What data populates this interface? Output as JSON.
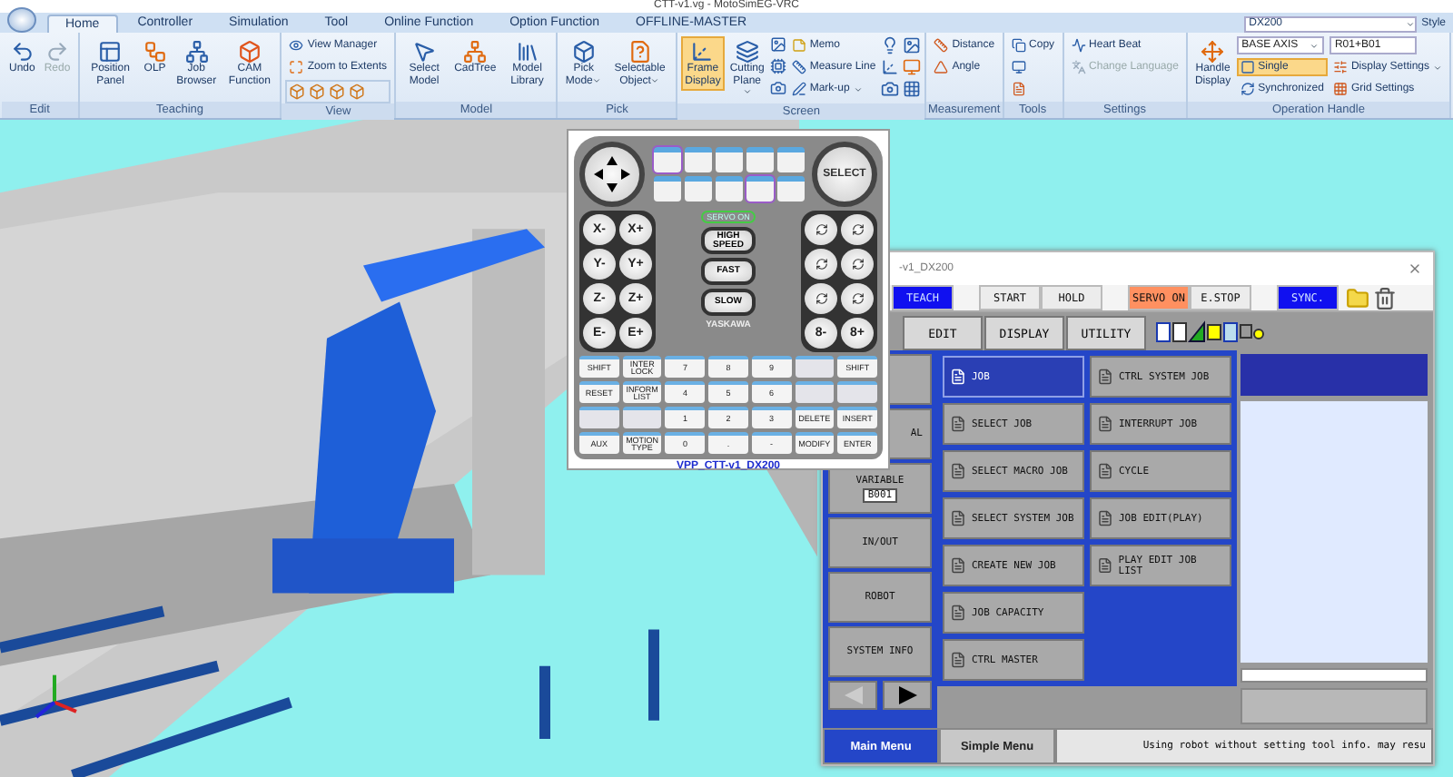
{
  "window": {
    "title": "CTT-v1.vg - MotoSimEG-VRC"
  },
  "ribbon": {
    "tabs": [
      {
        "label": "Home",
        "selected": true
      },
      {
        "label": "Controller",
        "selected": false
      },
      {
        "label": "Simulation",
        "selected": false
      },
      {
        "label": "Tool",
        "selected": false
      },
      {
        "label": "Online Function",
        "selected": false
      },
      {
        "label": "Option Function",
        "selected": false
      },
      {
        "label": "OFFLINE-MASTER",
        "selected": false
      }
    ],
    "controller": "DX200",
    "style_menu": "Style",
    "groups": [
      {
        "label": "Edit",
        "items": [
          {
            "kind": "large",
            "label": "Undo"
          },
          {
            "kind": "large",
            "label": "Redo",
            "disabled": true
          }
        ]
      },
      {
        "label": "Teaching",
        "items": [
          {
            "kind": "large",
            "label": "Position Panel"
          },
          {
            "kind": "large",
            "label": "OLP"
          },
          {
            "kind": "large",
            "label": "Job Browser"
          },
          {
            "kind": "large",
            "label": "CAM Function"
          }
        ]
      },
      {
        "label": "View",
        "items": [
          {
            "kind": "stack",
            "entries": [
              {
                "kind": "button",
                "label": "View Manager"
              },
              {
                "kind": "button",
                "label": "Zoom to Extents"
              },
              {
                "kind": "icon_row"
              }
            ]
          }
        ]
      },
      {
        "label": "Model",
        "items": [
          {
            "kind": "large",
            "label": "Select Model"
          },
          {
            "kind": "large",
            "label": "CadTree"
          },
          {
            "kind": "large",
            "label": "Model Library"
          }
        ]
      },
      {
        "label": "Pick",
        "items": [
          {
            "kind": "large",
            "label": "Pick Mode",
            "dropdown": true
          },
          {
            "kind": "large",
            "label": "Selectable Object",
            "dropdown": true
          }
        ]
      },
      {
        "label": "Screen",
        "items": [
          {
            "kind": "large",
            "label": "Frame Display",
            "selected": true
          },
          {
            "kind": "large",
            "label": "Cutting Plane",
            "dropdown": true
          },
          {
            "kind": "icon_column"
          },
          {
            "kind": "stack",
            "entries": [
              {
                "kind": "button",
                "label": "Memo"
              },
              {
                "kind": "button",
                "label": "Measure Line"
              },
              {
                "kind": "button",
                "label": "Mark-up",
                "dropdown": true
              }
            ]
          },
          {
            "kind": "icon_grid"
          }
        ]
      },
      {
        "label": "Measurement",
        "items": [
          {
            "kind": "stack",
            "entries": [
              {
                "kind": "button",
                "label": "Distance"
              },
              {
                "kind": "button",
                "label": "Angle"
              }
            ]
          }
        ]
      },
      {
        "label": "Tools",
        "items": [
          {
            "kind": "stack",
            "entries": [
              {
                "kind": "button",
                "label": "Copy"
              },
              {
                "kind": "icon"
              },
              {
                "kind": "icon"
              }
            ]
          }
        ]
      },
      {
        "label": "Settings",
        "items": [
          {
            "kind": "stack",
            "entries": [
              {
                "kind": "button",
                "label": "Heart Beat"
              },
              {
                "kind": "button",
                "label": "Change Language",
                "disabled": true
              }
            ]
          }
        ]
      },
      {
        "label": "Operation Handle",
        "items": [
          {
            "kind": "large",
            "label": "Handle Display"
          },
          {
            "kind": "stack",
            "entries": [
              {
                "kind": "select",
                "label": "BASE AXIS"
              },
              {
                "kind": "button",
                "label": "Single",
                "selected": true
              },
              {
                "kind": "button",
                "label": "Synchronized"
              }
            ]
          },
          {
            "kind": "stack",
            "entries": [
              {
                "kind": "field",
                "label": "R01+B01"
              },
              {
                "kind": "button",
                "label": "Display Settings",
                "dropdown": true
              },
              {
                "kind": "button",
                "label": "Grid Settings"
              }
            ]
          }
        ]
      }
    ]
  },
  "pendant": {
    "select_key": "SELECT",
    "servo_lamp": "SERVO ON",
    "jog_left": [
      "X-",
      "X+",
      "Y-",
      "Y+",
      "Z-",
      "Z+",
      "E-",
      "E+"
    ],
    "speed_keys": [
      "HIGH SPEED",
      "FAST",
      "SLOW"
    ],
    "jog_right_bottom": [
      "8-",
      "8+"
    ],
    "brand": "YASKAWA",
    "keypad": [
      {
        "label": "SHIFT"
      },
      {
        "label": "INTER LOCK"
      },
      {
        "label": "7"
      },
      {
        "label": "8"
      },
      {
        "label": "9"
      },
      {
        "kind": "blank"
      },
      {
        "label": "SHIFT"
      },
      {
        "label": "RESET"
      },
      {
        "label": "INFORM LIST"
      },
      {
        "label": "4"
      },
      {
        "label": "5"
      },
      {
        "label": "6"
      },
      {
        "kind": "blank"
      },
      {
        "kind": "blank"
      },
      {
        "kind": "blank"
      },
      {
        "kind": "blank"
      },
      {
        "label": "1"
      },
      {
        "label": "2"
      },
      {
        "label": "3"
      },
      {
        "label": "DELETE"
      },
      {
        "label": "INSERT"
      },
      {
        "label": "AUX"
      },
      {
        "label": "MOTION TYPE"
      },
      {
        "label": "0"
      },
      {
        "label": "."
      },
      {
        "label": "-"
      },
      {
        "label": "MODIFY"
      },
      {
        "label": "ENTER"
      }
    ],
    "caption": "VPP_CTT-v1_DX200"
  },
  "teach_panel": {
    "title": "-v1_DX200",
    "top_buttons": [
      {
        "label": "TEACH",
        "color": "#1010f0"
      },
      {
        "label": "START",
        "color": "#ececec"
      },
      {
        "label": "HOLD",
        "color": "#ececec"
      },
      {
        "label": "SERVO ON",
        "color": "#ff9060"
      },
      {
        "label": "E.STOP",
        "color": "#ececec"
      },
      {
        "label": "SYNC.",
        "color": "#1010f0"
      }
    ],
    "menu_tabs": [
      {
        "label": "EDIT"
      },
      {
        "label": "DISPLAY"
      },
      {
        "label": "UTILITY"
      }
    ],
    "side_menu": [
      {
        "label": "AL"
      },
      {
        "label": "VARIABLE",
        "value": "B001"
      },
      {
        "label": "IN/OUT"
      },
      {
        "label": "ROBOT"
      },
      {
        "label": "SYSTEM INFO"
      }
    ],
    "submenu": [
      [
        {
          "label": "JOB",
          "selected": true
        },
        {
          "label": "SELECT JOB",
          "selected": false
        },
        {
          "label": "SELECT MACRO JOB",
          "selected": false
        },
        {
          "label": "SELECT SYSTEM JOB",
          "selected": false
        },
        {
          "label": "CREATE NEW JOB",
          "selected": false
        },
        {
          "label": "JOB CAPACITY",
          "selected": false
        },
        {
          "label": "CTRL MASTER",
          "selected": false
        }
      ],
      [
        {
          "label": "CTRL SYSTEM JOB",
          "selected": false
        },
        {
          "label": "INTERRUPT JOB",
          "selected": false
        },
        {
          "label": "CYCLE",
          "selected": false
        },
        {
          "label": "JOB EDIT(PLAY)",
          "selected": false
        },
        {
          "label": "PLAY EDIT JOB LIST",
          "selected": false
        }
      ]
    ],
    "bottom_tabs": [
      {
        "label": "Main Menu",
        "selected": true
      },
      {
        "label": "Simple Menu",
        "selected": false
      }
    ],
    "message": "Using robot without setting tool info. may resu"
  }
}
